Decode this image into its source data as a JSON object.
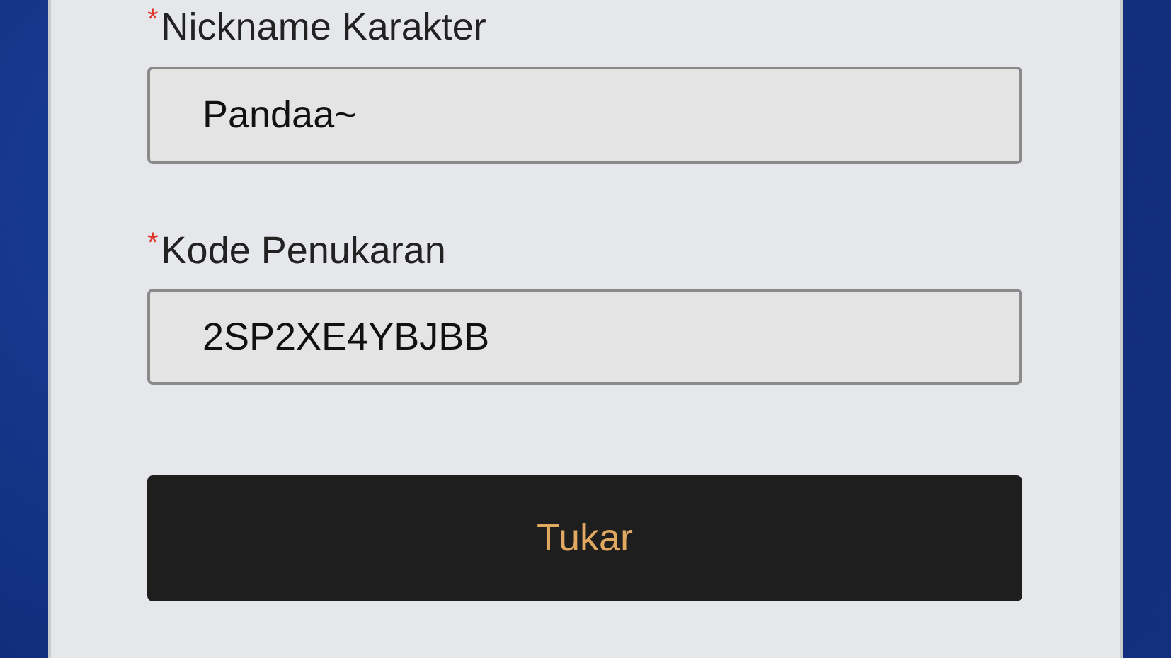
{
  "form": {
    "fields": [
      {
        "label": "Nickname Karakter",
        "required": true,
        "required_mark": "*",
        "value": "Pandaa~"
      },
      {
        "label": "Kode Penukaran",
        "required": true,
        "required_mark": "*",
        "value": "2SP2XE4YBJBB"
      }
    ],
    "submit_button": "Tukar"
  }
}
